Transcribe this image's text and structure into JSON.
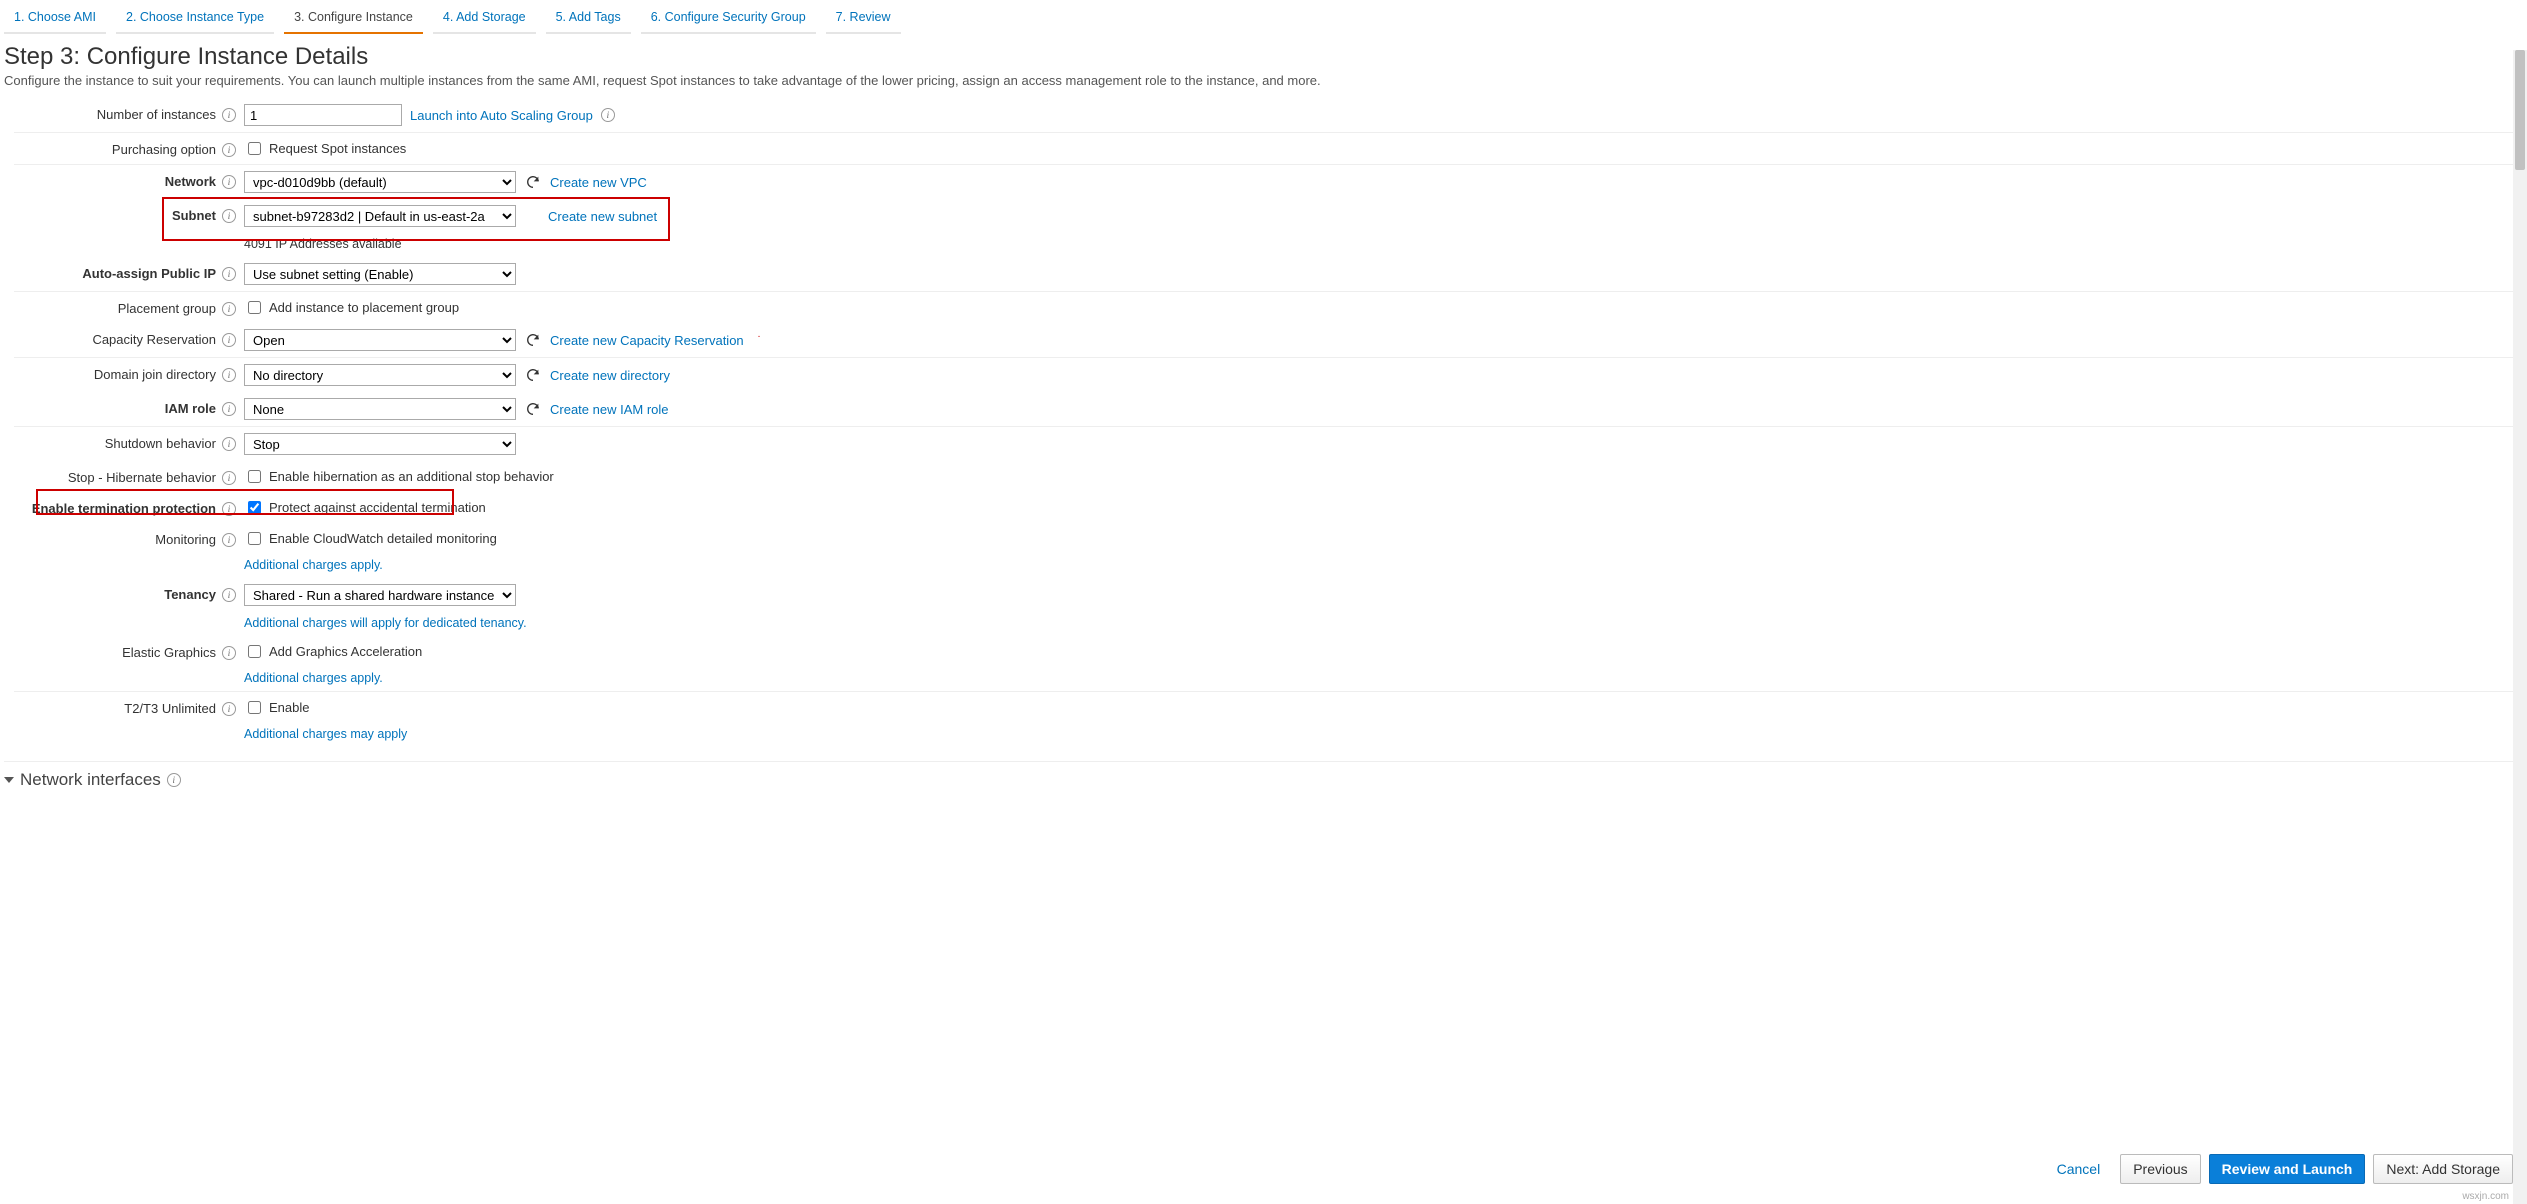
{
  "tabs": [
    "1. Choose AMI",
    "2. Choose Instance Type",
    "3. Configure Instance",
    "4. Add Storage",
    "5. Add Tags",
    "6. Configure Security Group",
    "7. Review"
  ],
  "activeTab": 2,
  "title": "Step 3: Configure Instance Details",
  "subtitle": "Configure the instance to suit your requirements. You can launch multiple instances from the same AMI, request Spot instances to take advantage of the lower pricing, assign an access management role to the instance, and more.",
  "labels": {
    "instances": "Number of instances",
    "purchasing": "Purchasing option",
    "network": "Network",
    "subnet": "Subnet",
    "autoip": "Auto-assign Public IP",
    "placement": "Placement group",
    "capacity": "Capacity Reservation",
    "domain": "Domain join directory",
    "iam": "IAM role",
    "shutdown": "Shutdown behavior",
    "hibernate": "Stop - Hibernate behavior",
    "termprot": "Enable termination protection",
    "monitoring": "Monitoring",
    "tenancy": "Tenancy",
    "elastic": "Elastic Graphics",
    "t2t3": "T2/T3 Unlimited"
  },
  "values": {
    "instances": "1",
    "network": "vpc-d010d9bb (default)",
    "subnet": "subnet-b97283d2 | Default in us-east-2a",
    "subnet_ips": "4091 IP Addresses available",
    "autoip": "Use subnet setting (Enable)",
    "capacity": "Open",
    "domain": "No directory",
    "iam": "None",
    "shutdown": "Stop",
    "tenancy": "Shared - Run a shared hardware instance"
  },
  "check_labels": {
    "spot": "Request Spot instances",
    "placement": "Add instance to placement group",
    "hibernate": "Enable hibernation as an additional stop behavior",
    "termprot": "Protect against accidental termination",
    "monitoring": "Enable CloudWatch detailed monitoring",
    "elastic": "Add Graphics Acceleration",
    "t2t3": "Enable"
  },
  "links": {
    "asg": "Launch into Auto Scaling Group",
    "newvpc": "Create new VPC",
    "newsubnet": "Create new subnet",
    "newcap": "Create new Capacity Reservation",
    "newdir": "Create new directory",
    "newiam": "Create new IAM role",
    "charges": "Additional charges apply.",
    "tenancy_charges": "Additional charges will apply for dedicated tenancy.",
    "maycharges": "Additional charges may apply"
  },
  "section": "Network interfaces",
  "footer": {
    "cancel": "Cancel",
    "prev": "Previous",
    "review": "Review and Launch",
    "next": "Next: Add Storage"
  },
  "watermark": "wsxjn.com"
}
